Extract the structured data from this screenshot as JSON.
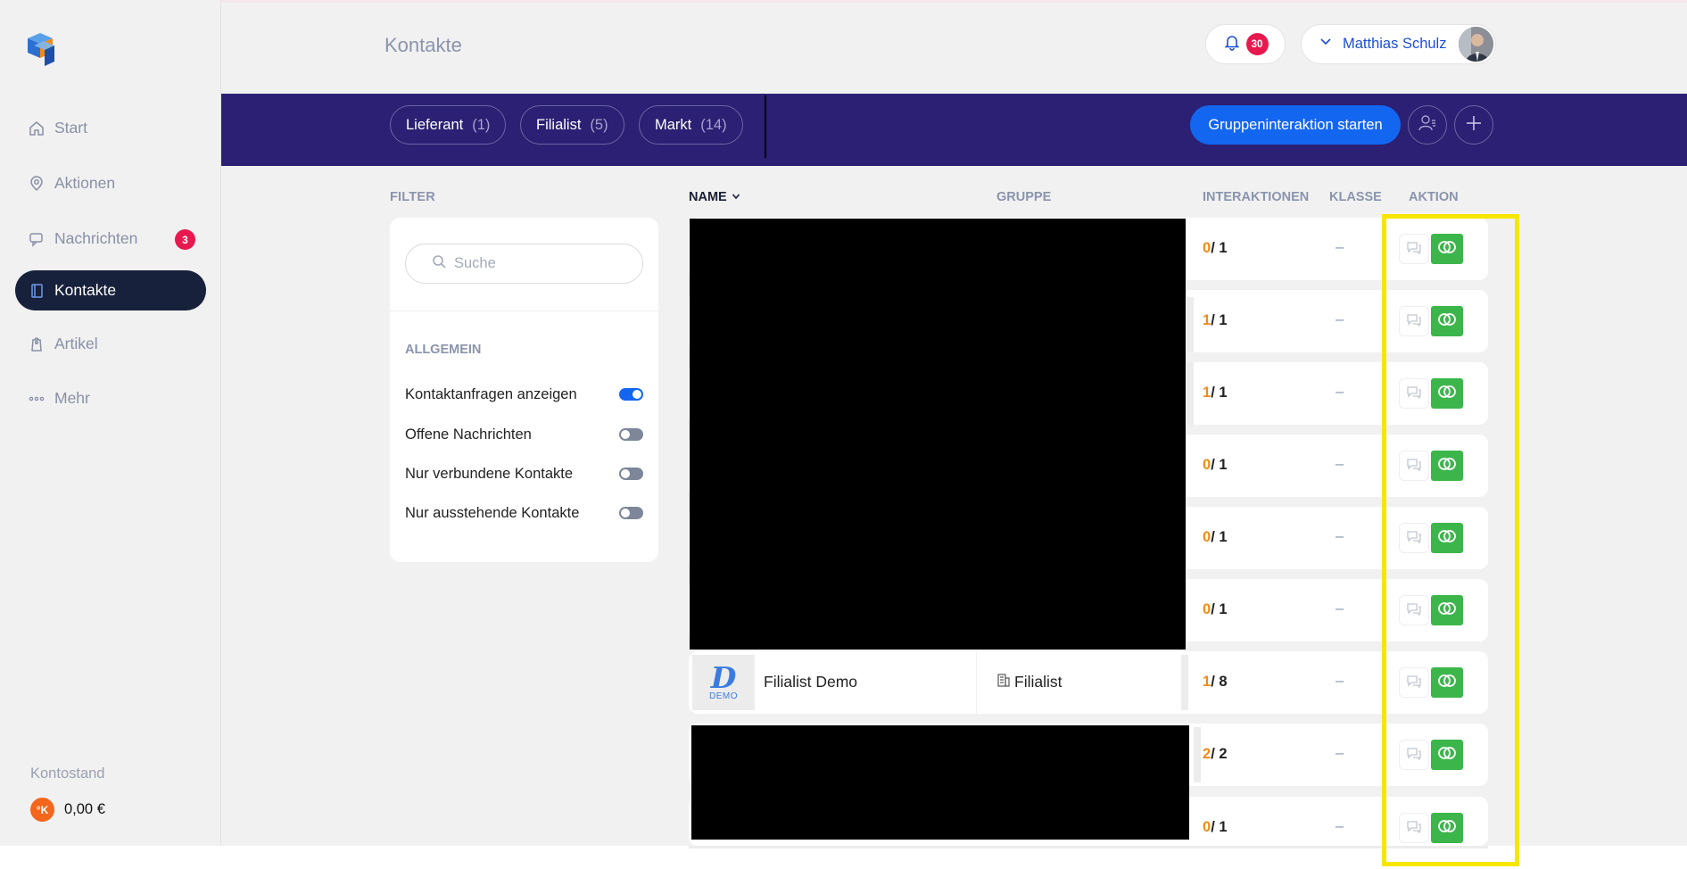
{
  "page": {
    "title": "Kontakte"
  },
  "sidebar": {
    "items": [
      {
        "label": "Start",
        "icon": "home-icon"
      },
      {
        "label": "Aktionen",
        "icon": "map-pin-icon"
      },
      {
        "label": "Nachrichten",
        "icon": "chat-icon",
        "badge": "3"
      },
      {
        "label": "Kontakte",
        "icon": "address-book-icon",
        "active": true
      },
      {
        "label": "Artikel",
        "icon": "tag-icon"
      },
      {
        "label": "Mehr",
        "icon": "more-dots-icon"
      }
    ],
    "balance_label": "Kontostand",
    "balance_value": "0,00 €",
    "coin_symbol": "°K"
  },
  "header": {
    "notifications_count": "30",
    "user_name": "Matthias Schulz"
  },
  "groups": {
    "chips": [
      {
        "label": "Lieferant",
        "count": "(1)"
      },
      {
        "label": "Filialist",
        "count": "(5)"
      },
      {
        "label": "Markt",
        "count": "(14)"
      }
    ],
    "start_button": "Gruppeninteraktion starten"
  },
  "filter": {
    "title": "FILTER",
    "search_placeholder": "Suche",
    "section": "ALLGEMEIN",
    "toggles": [
      {
        "label": "Kontaktanfragen anzeigen",
        "on": true
      },
      {
        "label": "Offene Nachrichten",
        "on": false
      },
      {
        "label": "Nur verbundene Kontakte",
        "on": false
      },
      {
        "label": "Nur ausstehende Kontakte",
        "on": false
      }
    ]
  },
  "table": {
    "headers": {
      "name": "NAME",
      "gruppe": "GRUPPE",
      "interaktionen": "INTERAKTIONEN",
      "klasse": "KLASSE",
      "aktion": "AKTION"
    },
    "rows": [
      {
        "int_a": "0",
        "int_b": "/ 1",
        "klasse": "–"
      },
      {
        "int_a": "1",
        "int_b": "/ 1",
        "klasse": "–"
      },
      {
        "int_a": "1",
        "int_b": "/ 1",
        "klasse": "–"
      },
      {
        "int_a": "0",
        "int_b": "/ 1",
        "klasse": "–"
      },
      {
        "int_a": "0",
        "int_b": "/ 1",
        "klasse": "–"
      },
      {
        "int_a": "0",
        "int_b": "/ 1",
        "klasse": "–"
      },
      {
        "int_a": "1",
        "int_b": "/ 8",
        "klasse": "–",
        "name": "Filialist Demo",
        "group": "Filialist",
        "logo_letter": "D",
        "logo_text": "DEMO"
      },
      {
        "int_a": "2",
        "int_b": "/ 2",
        "klasse": "–"
      },
      {
        "int_a": "0",
        "int_b": "/ 1",
        "klasse": "–"
      }
    ]
  },
  "colors": {
    "accent": "#1366f0",
    "groupbar": "#2b2073",
    "active_nav": "#17213b",
    "connect": "#3cb64b",
    "badge": "#e8194f",
    "highlight": "#f7e600"
  }
}
